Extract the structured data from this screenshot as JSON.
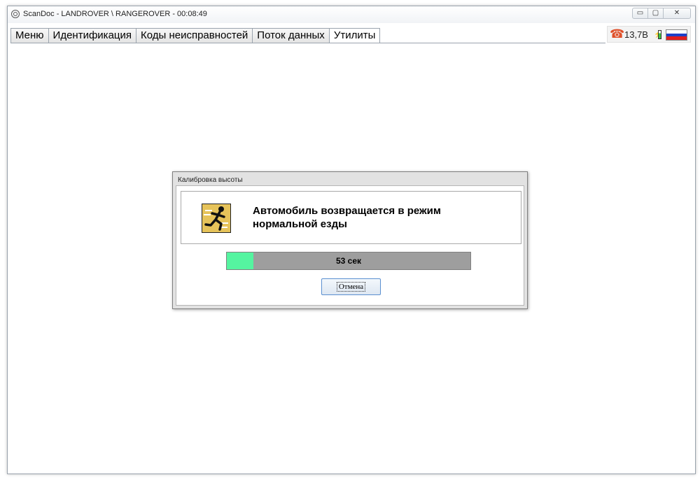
{
  "window": {
    "title": "ScanDoc - LANDROVER \\ RANGEROVER - 00:08:49",
    "minimize_glyph": "▭",
    "maximize_glyph": "▢",
    "close_glyph": "✕"
  },
  "tabs": [
    {
      "label": "Меню"
    },
    {
      "label": "Идентификация"
    },
    {
      "label": "Коды неисправностей"
    },
    {
      "label": "Поток данных"
    },
    {
      "label": "Утилиты"
    }
  ],
  "active_tab": 4,
  "status": {
    "voltage": "13,7В",
    "phone_icon": "phone-icon",
    "battery_icon": "battery-icon",
    "battery_level_fraction": 0.7,
    "flag_icon": "russian-flag-icon",
    "colors": {
      "phone": "#e0502a",
      "flag_white": "#ffffff",
      "flag_blue": "#1d3fc8",
      "flag_red": "#e01e1e"
    }
  },
  "dialog": {
    "title": "Калибровка высоты",
    "icon": "running-man-icon",
    "message": "Автомобиль возвращается в режим нормальной езды",
    "progress_text": "53 сек",
    "progress_fraction": 0.11,
    "progress_color": "#55f4a0",
    "cancel_label": "Отмена"
  }
}
